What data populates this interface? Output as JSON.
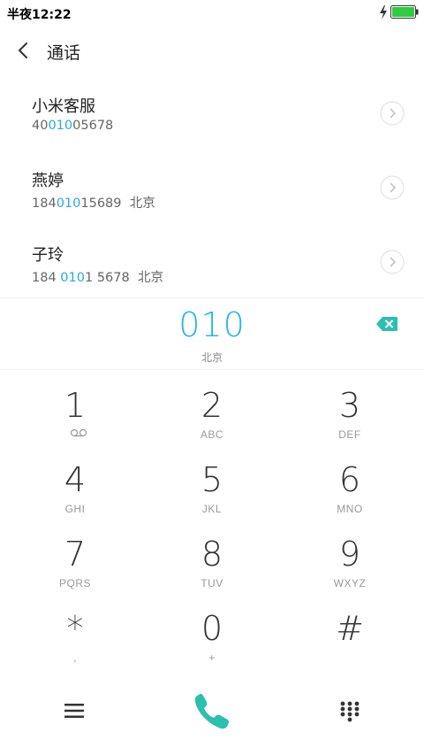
{
  "status_bar": {
    "time": "半夜12:22",
    "battery_color": "#2ecc40"
  },
  "header": {
    "title": "通话"
  },
  "contacts": [
    {
      "name": "小米客服",
      "number_pre": "40",
      "number_hl": "010",
      "number_post": "05678",
      "location": ""
    },
    {
      "name": "燕婷",
      "number_pre": "184",
      "number_hl": "010",
      "number_post": "15689",
      "location": "北京"
    },
    {
      "name": "子玲",
      "number_pre": "184 ",
      "number_hl": "010",
      "number_post": "1 5678",
      "location": "北京"
    }
  ],
  "dial": {
    "number": "010",
    "location": "北京"
  },
  "keypad": {
    "keys": [
      {
        "digit": "1",
        "letters": "",
        "icon": "voicemail-icon"
      },
      {
        "digit": "2",
        "letters": "ABC"
      },
      {
        "digit": "3",
        "letters": "DEF"
      },
      {
        "digit": "4",
        "letters": "GHI"
      },
      {
        "digit": "5",
        "letters": "JKL"
      },
      {
        "digit": "6",
        "letters": "MNO"
      },
      {
        "digit": "7",
        "letters": "PQRS"
      },
      {
        "digit": "8",
        "letters": "TUV"
      },
      {
        "digit": "9",
        "letters": "WXYZ"
      },
      {
        "digit": "*",
        "letters": ","
      },
      {
        "digit": "0",
        "letters": "+"
      },
      {
        "digit": "#",
        "letters": ""
      }
    ]
  },
  "colors": {
    "accent": "#29b6e8",
    "call": "#2bbfb0",
    "backspace": "#2bbfb0"
  }
}
